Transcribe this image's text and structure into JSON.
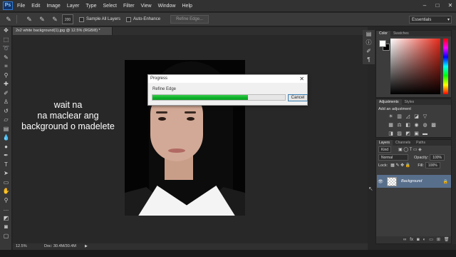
{
  "menubar": {
    "logo": "Ps",
    "items": [
      "File",
      "Edit",
      "Image",
      "Layer",
      "Type",
      "Select",
      "Filter",
      "View",
      "Window",
      "Help"
    ],
    "controls": [
      "–",
      "□",
      "✕"
    ]
  },
  "options": {
    "brush_size": "200",
    "sample_all_layers": "Sample All Layers",
    "auto_enhance": "Auto-Enhance",
    "refine_edge": "Refine Edge...",
    "workspace": "Essentials"
  },
  "document": {
    "tab_title": "2x2 white background(1).jpg @ 12.5% (RGB/8) *",
    "zoom": "12.5%",
    "doc_size": "Doc: 30.4M/30.4M"
  },
  "overlay": {
    "line1": "wait na",
    "line2": "na maclear ang",
    "line3": "background o madelete"
  },
  "progress_dialog": {
    "title": "Progress",
    "close": "✕",
    "operation": "Refine Edge",
    "progress": 0.72,
    "cancel": "Cancel"
  },
  "color_panel": {
    "tabs": [
      "Color",
      "Swatches"
    ]
  },
  "adjustments_panel": {
    "tabs": [
      "Adjustments",
      "Styles"
    ],
    "title": "Add an adjustment"
  },
  "layers_panel": {
    "tabs": [
      "Layers",
      "Channels",
      "Paths"
    ],
    "kind": "Kind",
    "blend_mode": "Normal",
    "opacity_label": "Opacity:",
    "opacity": "100%",
    "lock_label": "Lock:",
    "fill_label": "Fill:",
    "fill": "100%",
    "layer_name": "Background"
  }
}
